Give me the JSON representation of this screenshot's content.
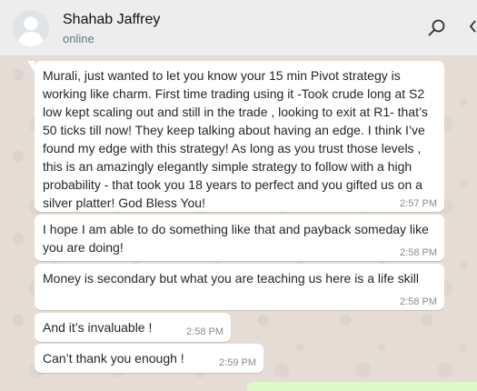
{
  "header": {
    "contact_name": "Shahab Jaffrey",
    "status": "online",
    "icons": [
      "search-icon",
      "menu-icon"
    ]
  },
  "messages": [
    {
      "text": "Murali, just wanted to let you know your 15 min Pivot strategy is\nworking like charm. First time trading using it -Took crude long at S2\nlow kept scaling out and still in the trade , looking to exit at R1- that’s\n50 ticks till now! They keep talking about having an edge. I think I’ve\nfound my edge with this strategy! As long as you trust those levels ,\nthis is an amazingly elegantly simple strategy to follow with a high\nprobability - that took you 18 years to perfect and you gifted us on a\nsilver platter! God Bless You!",
      "time": "2:57 PM"
    },
    {
      "text": "I hope I am able to do something like that and payback someday like\nyou are doing!",
      "time": "2:58 PM"
    },
    {
      "text": "Money is secondary but what you are teaching us here is a life skill",
      "time": "2:58 PM"
    },
    {
      "text": "And it’s invaluable !",
      "time": "2:58 PM"
    },
    {
      "text": "Can’t thank you enough !",
      "time": "2:59 PM"
    }
  ],
  "colors": {
    "header_bg": "#ededed",
    "chat_bg": "#e5ddd5",
    "incoming_bubble": "#ffffff",
    "outgoing_bubble": "#dcf8c6"
  }
}
